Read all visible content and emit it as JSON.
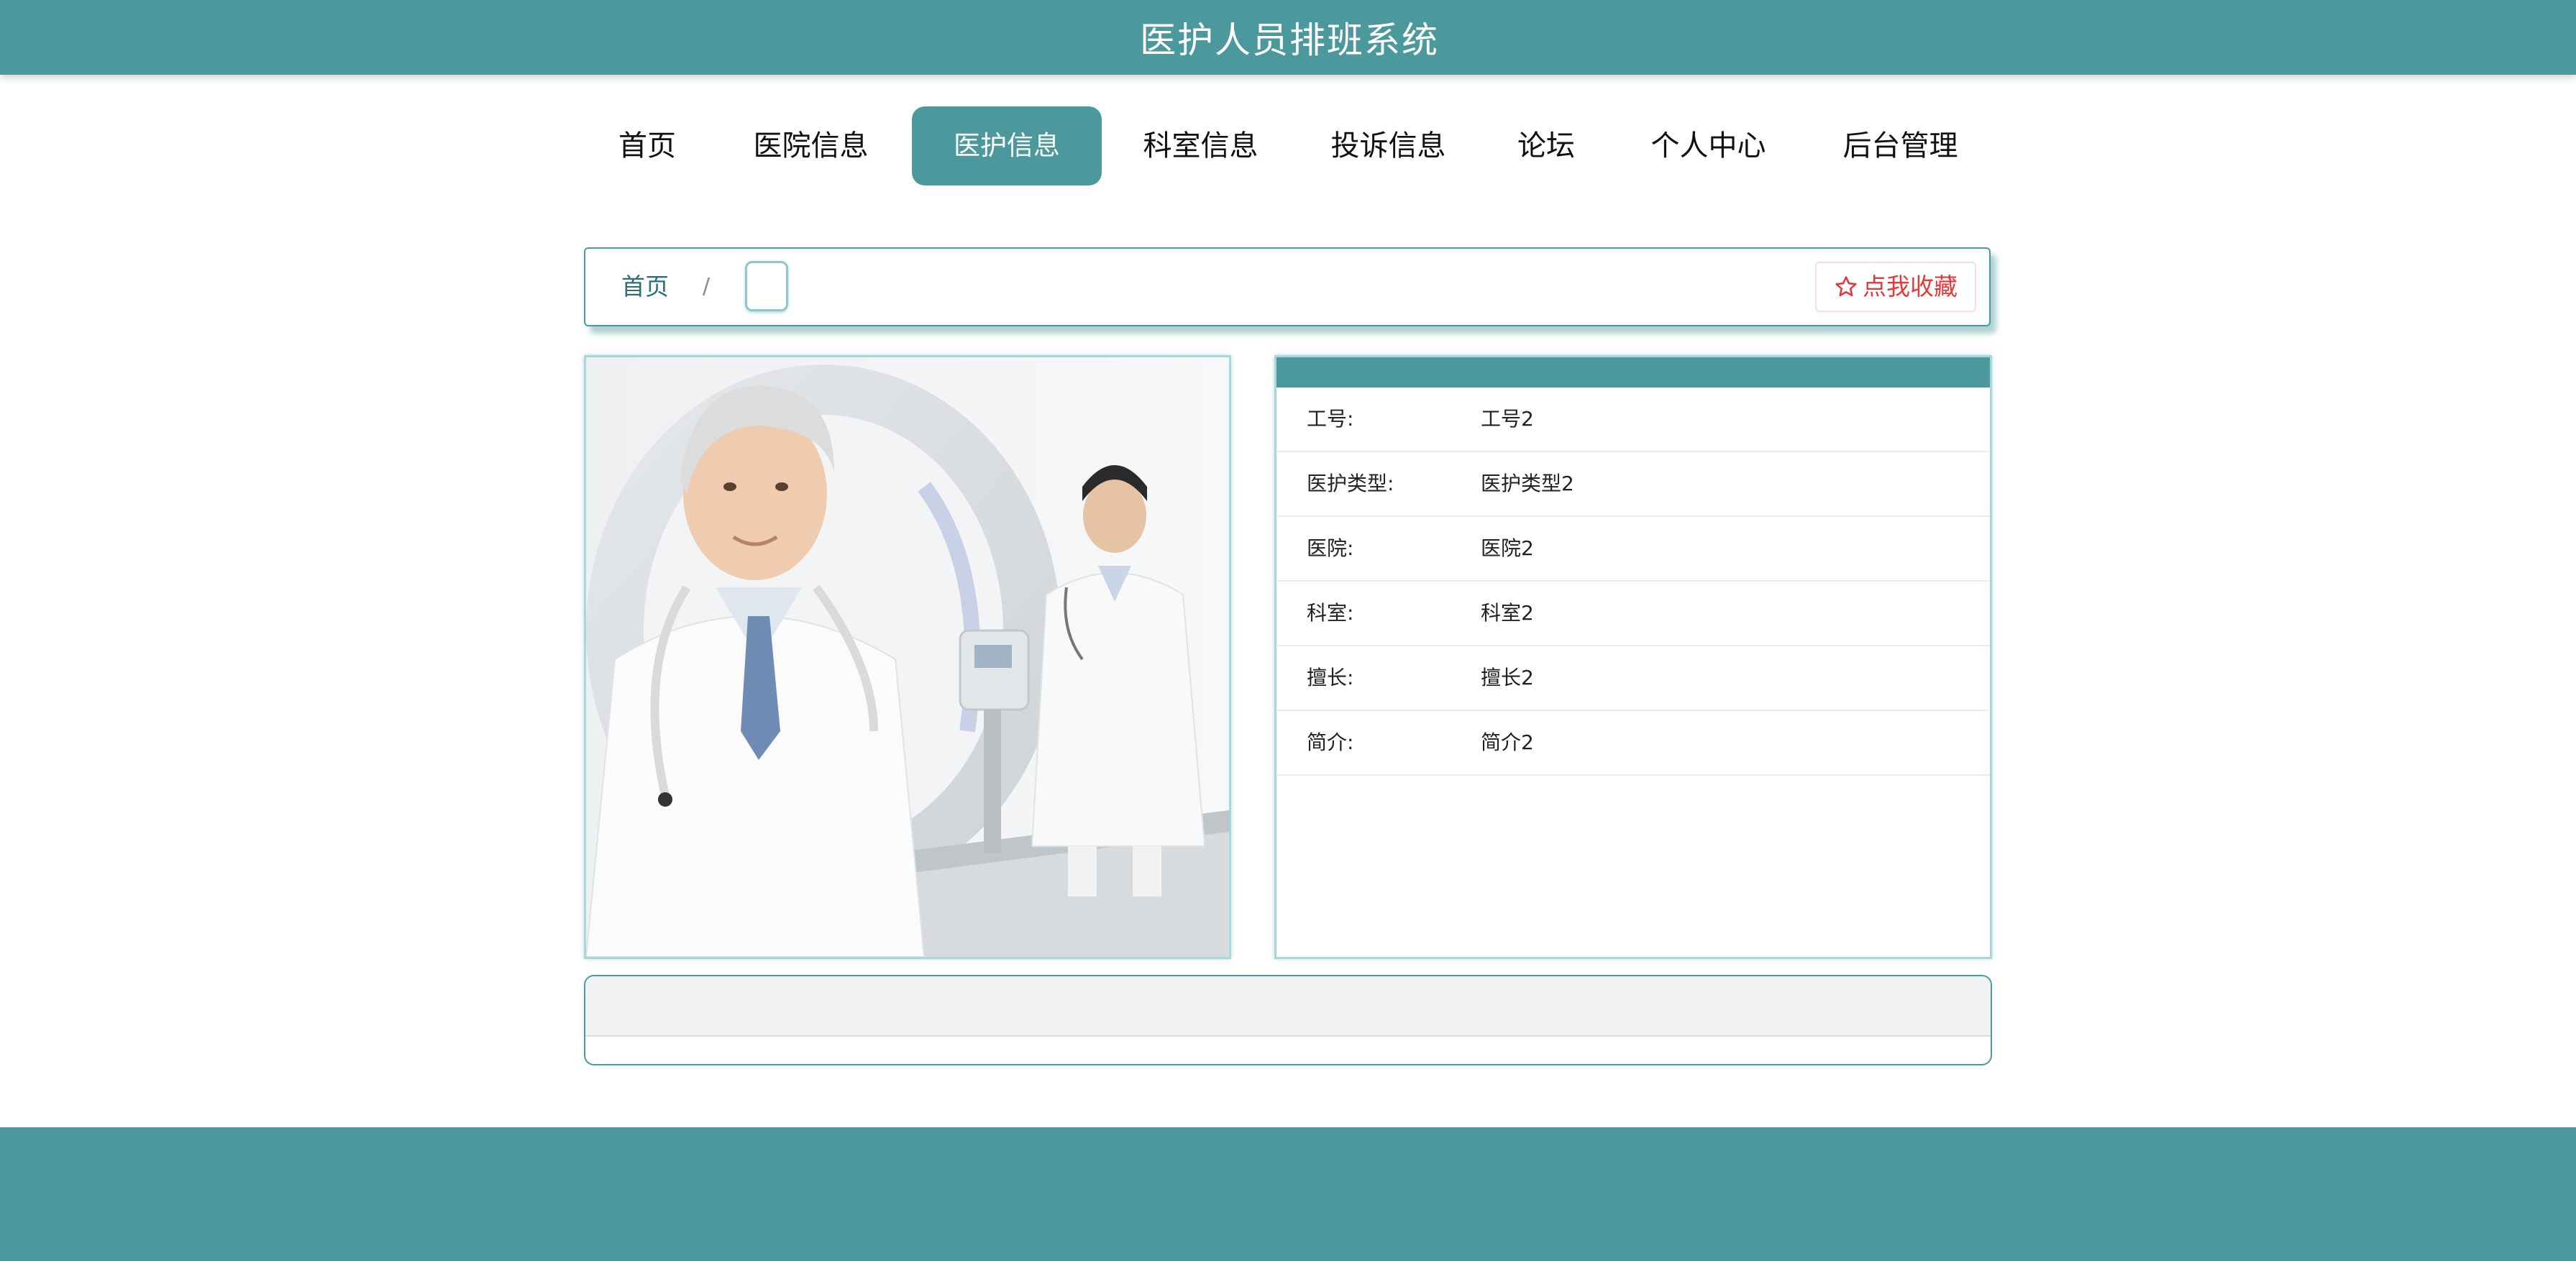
{
  "header": {
    "title": "医护人员排班系统"
  },
  "nav": {
    "items": [
      {
        "label": "首页"
      },
      {
        "label": "医院信息"
      },
      {
        "label": "医护信息"
      },
      {
        "label": "科室信息"
      },
      {
        "label": "投诉信息"
      },
      {
        "label": "论坛"
      },
      {
        "label": "个人中心"
      },
      {
        "label": "后台管理"
      }
    ],
    "active": "医护信息"
  },
  "breadcrumb": {
    "home": "首页",
    "separator": "/",
    "current": ""
  },
  "favorite": {
    "label": "点我收藏",
    "icon": "star-outline-icon",
    "color": "#e4393c"
  },
  "detail": {
    "rows": [
      {
        "label": "工号:",
        "value": "工号2"
      },
      {
        "label": "医护类型:",
        "value": "医护类型2"
      },
      {
        "label": "医院:",
        "value": "医院2"
      },
      {
        "label": "科室:",
        "value": "科室2"
      },
      {
        "label": "擅长:",
        "value": "擅长2"
      },
      {
        "label": "简介:",
        "value": "简介2"
      }
    ]
  },
  "theme": {
    "primary": "#4c999d",
    "text": "#111111"
  }
}
